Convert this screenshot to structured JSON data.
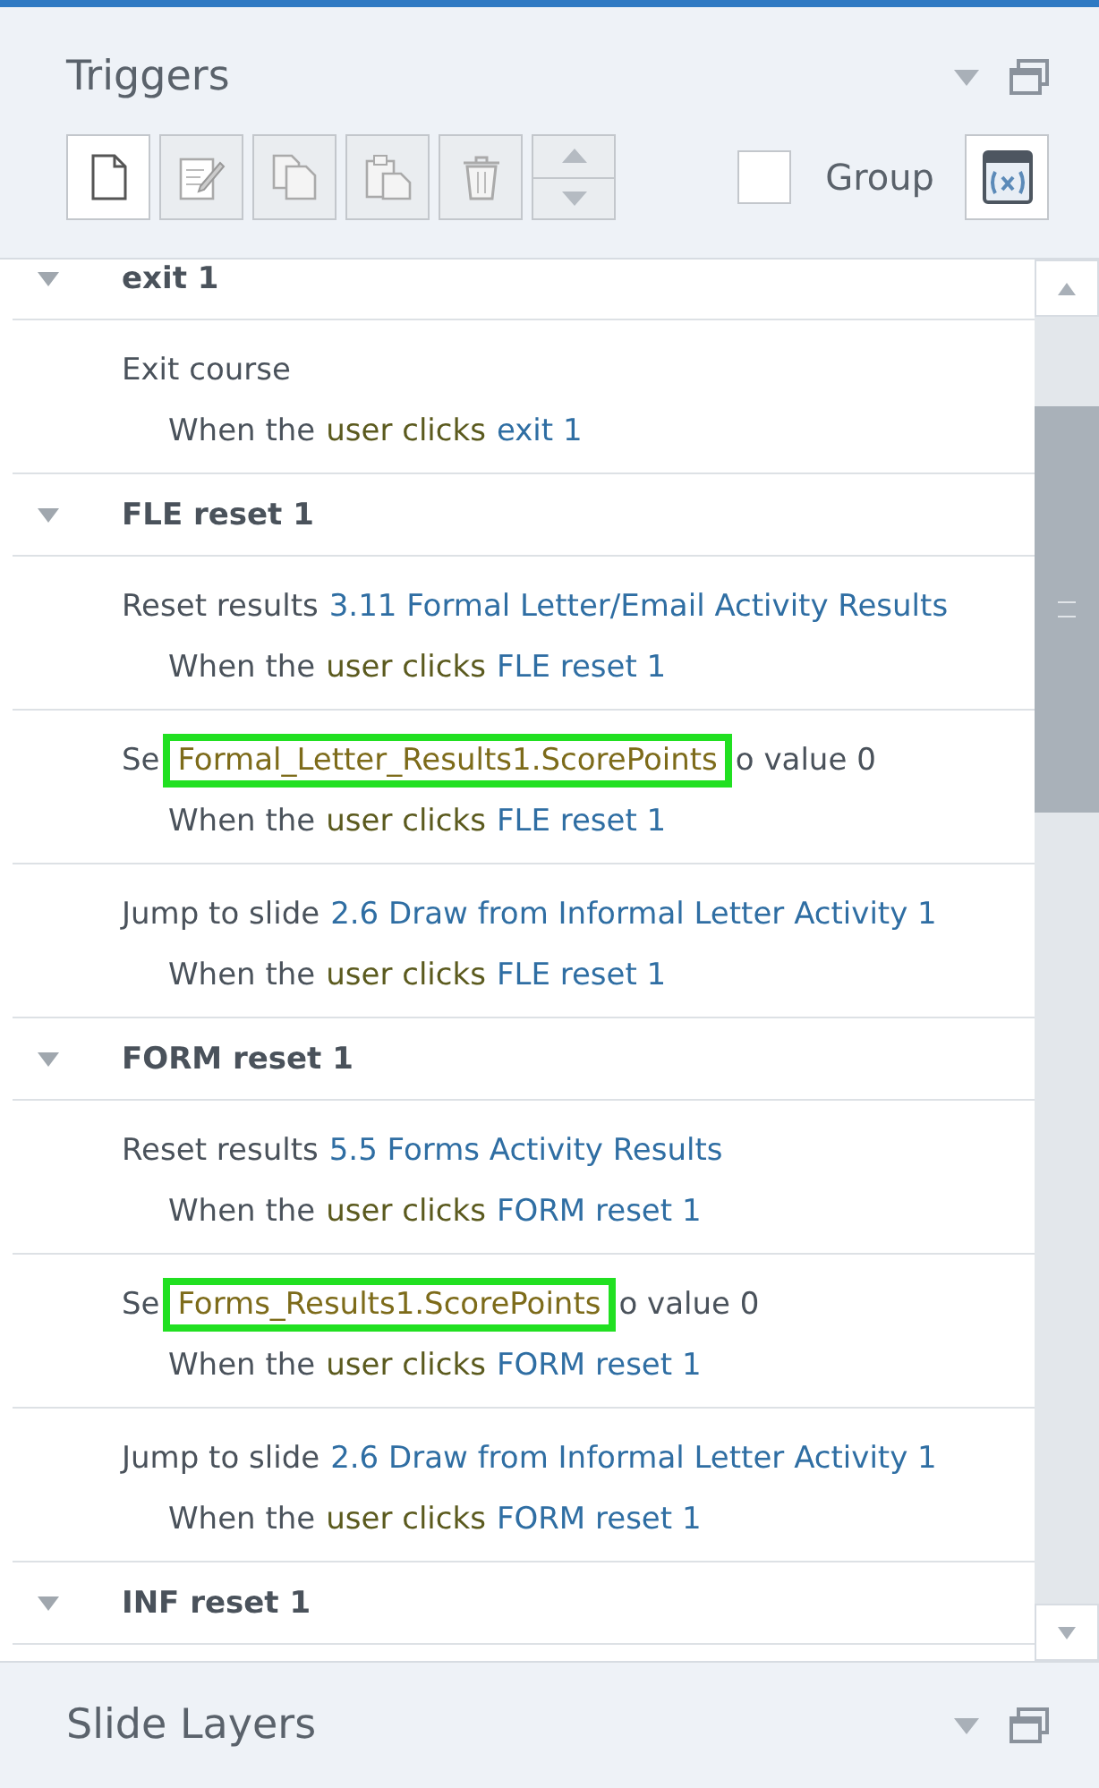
{
  "panel": {
    "title": "Triggers"
  },
  "toolbar": {
    "group_label": "Group",
    "group_checked": false
  },
  "groups": [
    {
      "name": "exit 1",
      "expanded": true,
      "triggers": [
        {
          "action": [
            {
              "kind": "plain",
              "text": "Exit course"
            }
          ],
          "condition": [
            {
              "kind": "plain",
              "text": "When the"
            },
            {
              "kind": "keyword",
              "text": "user clicks"
            },
            {
              "kind": "link",
              "text": "exit 1"
            }
          ]
        }
      ]
    },
    {
      "name": "FLE reset 1",
      "expanded": true,
      "triggers": [
        {
          "action": [
            {
              "kind": "plain",
              "text": "Reset results"
            },
            {
              "kind": "link",
              "text": "3.11 Formal Letter/Email Activity Results"
            }
          ],
          "condition": [
            {
              "kind": "plain",
              "text": "When the"
            },
            {
              "kind": "keyword",
              "text": "user clicks"
            },
            {
              "kind": "link",
              "text": "FLE reset 1"
            }
          ]
        },
        {
          "action": [
            {
              "kind": "plain",
              "text": "Se"
            },
            {
              "kind": "highlighted",
              "text": "Formal_Letter_Results1.ScorePoints"
            },
            {
              "kind": "plain",
              "text": "o value 0"
            }
          ],
          "condition": [
            {
              "kind": "plain",
              "text": "When the"
            },
            {
              "kind": "keyword",
              "text": "user clicks"
            },
            {
              "kind": "link",
              "text": "FLE reset 1"
            }
          ]
        },
        {
          "action": [
            {
              "kind": "plain",
              "text": "Jump to slide"
            },
            {
              "kind": "link",
              "text": "2.6 Draw from Informal Letter Activity 1"
            }
          ],
          "condition": [
            {
              "kind": "plain",
              "text": "When the"
            },
            {
              "kind": "keyword",
              "text": "user clicks"
            },
            {
              "kind": "link",
              "text": "FLE reset 1"
            }
          ]
        }
      ]
    },
    {
      "name": "FORM reset 1",
      "expanded": true,
      "triggers": [
        {
          "action": [
            {
              "kind": "plain",
              "text": "Reset results"
            },
            {
              "kind": "link",
              "text": "5.5 Forms Activity Results"
            }
          ],
          "condition": [
            {
              "kind": "plain",
              "text": "When the"
            },
            {
              "kind": "keyword",
              "text": "user clicks"
            },
            {
              "kind": "link",
              "text": "FORM reset 1"
            }
          ]
        },
        {
          "action": [
            {
              "kind": "plain",
              "text": "Se"
            },
            {
              "kind": "highlighted",
              "text": "Forms_Results1.ScorePoints"
            },
            {
              "kind": "plain",
              "text": "o value 0"
            }
          ],
          "condition": [
            {
              "kind": "plain",
              "text": "When the"
            },
            {
              "kind": "keyword",
              "text": "user clicks"
            },
            {
              "kind": "link",
              "text": "FORM reset 1"
            }
          ]
        },
        {
          "action": [
            {
              "kind": "plain",
              "text": "Jump to slide"
            },
            {
              "kind": "link",
              "text": "2.6 Draw from Informal Letter Activity 1"
            }
          ],
          "condition": [
            {
              "kind": "plain",
              "text": "When the"
            },
            {
              "kind": "keyword",
              "text": "user clicks"
            },
            {
              "kind": "link",
              "text": "FORM reset 1"
            }
          ]
        }
      ]
    },
    {
      "name": "INF reset 1",
      "expanded": true
    }
  ],
  "bottom_panel": {
    "title": "Slide Layers"
  }
}
